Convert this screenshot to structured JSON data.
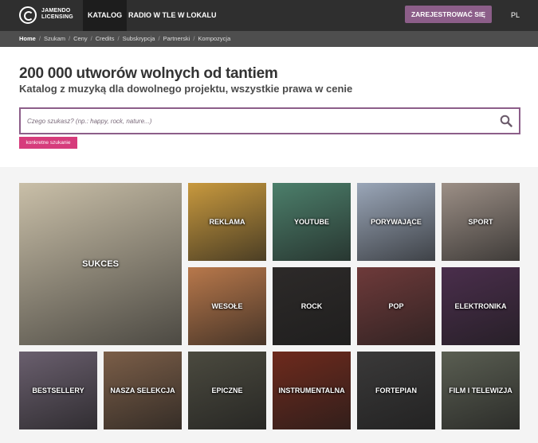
{
  "header": {
    "logo_line1": "JAMENDO",
    "logo_line2": "LICENSING",
    "nav": [
      "KATALOG",
      "RADIO W TLE W LOKALU"
    ],
    "register_label": "ZAREJESTROWAĆ SIĘ",
    "language": "PL"
  },
  "breadcrumb": [
    "Home",
    "Szukam",
    "Ceny",
    "Credits",
    "Subskrypcja",
    "Partnerski",
    "Kompozycja"
  ],
  "hero": {
    "title": "200 000 utworów wolnych od tantiem",
    "subtitle": "Katalog z muzyką dla dowolnego projektu, wszystkie prawa w cenie",
    "search_placeholder": "Czego szukasz? (np.: happy, rock, nature...)",
    "advanced_search_label": "konkretne szukanie"
  },
  "categories": [
    {
      "label": "SUKCES",
      "color": "#c9bfa8"
    },
    {
      "label": "REKLAMA",
      "color": "#c8993e"
    },
    {
      "label": "YOUTUBE",
      "color": "#4c7f6b"
    },
    {
      "label": "PORYWAJĄCE",
      "color": "#9aa6b8"
    },
    {
      "label": "SPORT",
      "color": "#9c8f86"
    },
    {
      "label": "WESOŁE",
      "color": "#b8784b"
    },
    {
      "label": "ROCK",
      "color": "#2d2a29"
    },
    {
      "label": "POP",
      "color": "#6e3a3a"
    },
    {
      "label": "ELEKTRONIKA",
      "color": "#4a2e4c"
    },
    {
      "label": "BESTSELLERY",
      "color": "#6a5f6e"
    },
    {
      "label": "NASZA SELEKCJA",
      "color": "#7b5e48"
    },
    {
      "label": "EPICZNE",
      "color": "#4b4a3f"
    },
    {
      "label": "INSTRUMENTALNA",
      "color": "#6e2a1d"
    },
    {
      "label": "FORTEPIAN",
      "color": "#3a3939"
    },
    {
      "label": "FILM I TELEWIZJA",
      "color": "#5a5e52"
    }
  ]
}
